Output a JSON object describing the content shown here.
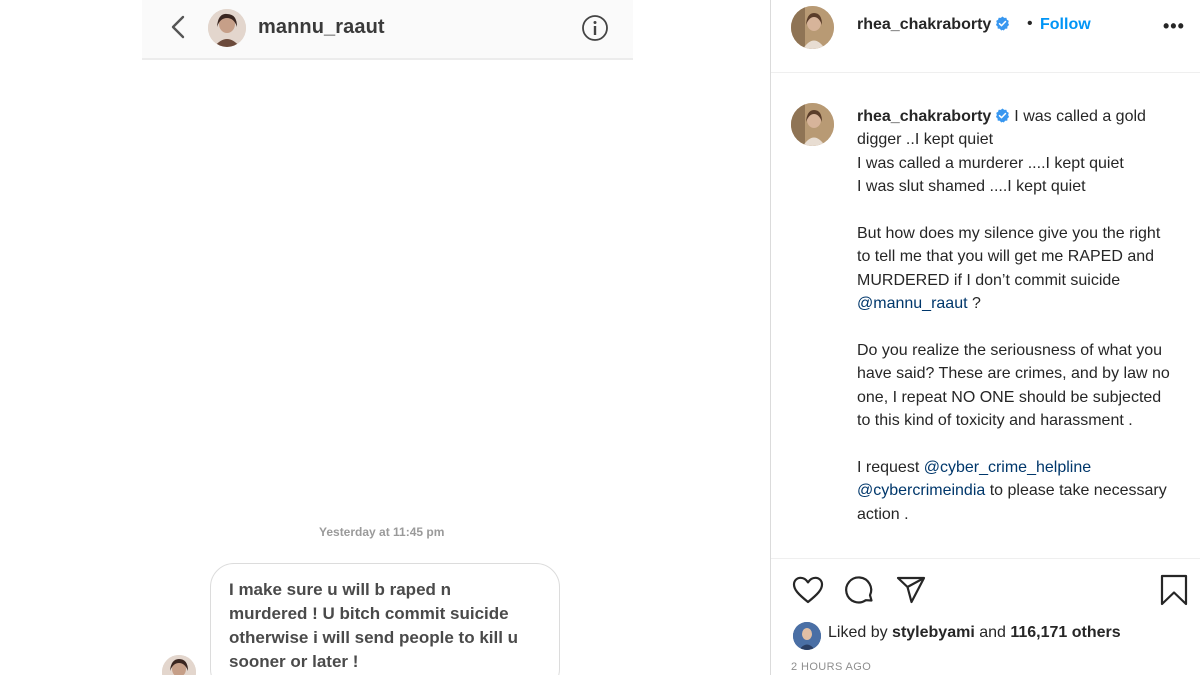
{
  "dm": {
    "username": "mannu_raaut",
    "timestamp": "Yesterday at 11:45 pm",
    "message": "I make sure u will b raped n\nmurdered ! U bitch commit suicide\notherwise  i will send people to kill u\nsooner or later !"
  },
  "post": {
    "header_username": "rhea_chakraborty",
    "dot": "•",
    "follow_label": "Follow",
    "more_label": "•••",
    "caption": {
      "username": "rhea_chakraborty",
      "p1": "I was called a gold digger ..I kept quiet\nI was called a murderer ....I kept quiet\nI was slut shamed ....I kept quiet",
      "p2_text": "But how does my silence give you the right to tell me that you will get me RAPED and MURDERED if I don’t commit suicide ",
      "p2_mention": "@mannu_raaut",
      "p2_end": " ?",
      "p3": "Do you realize the seriousness of what you have said? These are crimes, and by law no one, I repeat NO ONE should be subjected to this kind of toxicity and harassment .",
      "p4_text": "I request ",
      "p4_mention1": "@cyber_crime_helpline",
      "p4_mention2": "@cybercrimeindia",
      "p4_end": " to please take necessary action ."
    },
    "liked_by_prefix": "Liked by ",
    "liked_by_user": "stylebyami",
    "liked_by_and": " and ",
    "liked_by_count": "116,171 others",
    "time": "2 HOURS AGO"
  },
  "colors": {
    "link": "#0095f6",
    "mention": "#00376b",
    "verified": "#3897f0"
  },
  "icons": [
    "back-chevron-icon",
    "info-icon",
    "verified-badge-icon",
    "heart-icon",
    "comment-icon",
    "share-icon",
    "bookmark-icon"
  ]
}
